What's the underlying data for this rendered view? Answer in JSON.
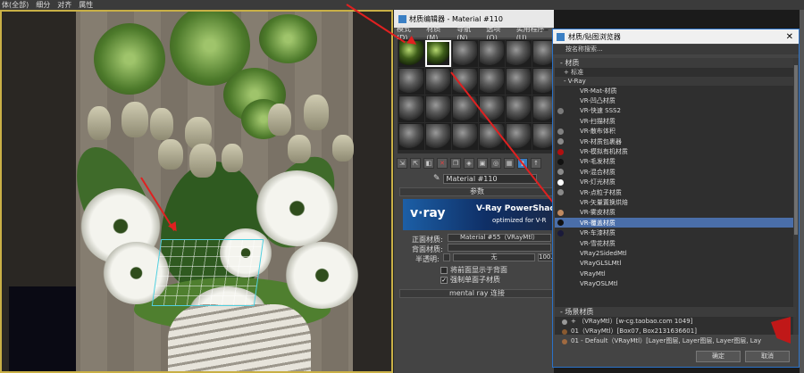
{
  "menubar": {
    "items": [
      "体(全部)",
      "细分",
      "对齐",
      "属性"
    ]
  },
  "material_editor": {
    "title": "材质编辑器 - Material #110",
    "menus": [
      "模式(D)",
      "材质(M)",
      "导航(N)",
      "选项(O)",
      "实用程序(U)"
    ],
    "material_name": "Material #110",
    "params_title": "参数",
    "banner_logo": "v·ray",
    "banner_title": "V-Ray PowerShade",
    "banner_sub": "optimized for V-R",
    "front_label": "正面材质:",
    "front_value": "Material #55（VRayMtl）",
    "back_label": "背面材质:",
    "translucency_label": "半透明:",
    "translucency_value": "无",
    "translucency_num": "100.0",
    "check1": "将前面显示于背面",
    "check2": "强制单面子材质",
    "mental_ray": "mental ray 连接"
  },
  "browser": {
    "title": "材质/贴图浏览器",
    "search_placeholder": "按名称搜索...",
    "section_materials": "- 材质",
    "standard": "+ 标准",
    "vray_group": "- V-Ray",
    "items": [
      {
        "label": "VR-Mat-材质",
        "color": ""
      },
      {
        "label": "VR-凹凸材质",
        "color": ""
      },
      {
        "label": "VR-快速 SSS2",
        "color": "#7a7a7a"
      },
      {
        "label": "VR-扫描材质",
        "color": ""
      },
      {
        "label": "VR-散布体积",
        "color": "#808080"
      },
      {
        "label": "VR-材质包裹器",
        "color": "#8a8a8a"
      },
      {
        "label": "VR-模拟有机材质",
        "color": "#b01010"
      },
      {
        "label": "VR-毛发材质",
        "color": "#111111"
      },
      {
        "label": "VR-混合材质",
        "color": "#8a8a8a"
      },
      {
        "label": "VR-灯光材质",
        "color": "#ffffff"
      },
      {
        "label": "VR-点粒子材质",
        "color": "#8a8a8a"
      },
      {
        "label": "VR-矢量置换烘焙",
        "color": ""
      },
      {
        "label": "VR-雾皮材质",
        "color": "#c08a60"
      },
      {
        "label": "VR-覆盖材质",
        "color": "#111111"
      },
      {
        "label": "VR-车漆材质",
        "color": "#1a1a3a"
      },
      {
        "label": "VR-雪花材质",
        "color": ""
      },
      {
        "label": "VRay2SidedMtl",
        "color": ""
      },
      {
        "label": "VRayGLSLMtl",
        "color": ""
      },
      {
        "label": "VRayMtl",
        "color": ""
      },
      {
        "label": "VRayOSLMtl",
        "color": ""
      }
    ],
    "highlighted_index": 13,
    "section_scene": "- 场景材质",
    "scene_rows": [
      "+ （VRayMtl）[w-cg.taobao.com          1049]",
      "01（VRayMtl）[Box07, Box2131636601]",
      "01 - Default（VRayMtl）[Layer图层, Layer图层, Layer图层, Lay"
    ],
    "ok": "确定",
    "cancel": "取消"
  }
}
